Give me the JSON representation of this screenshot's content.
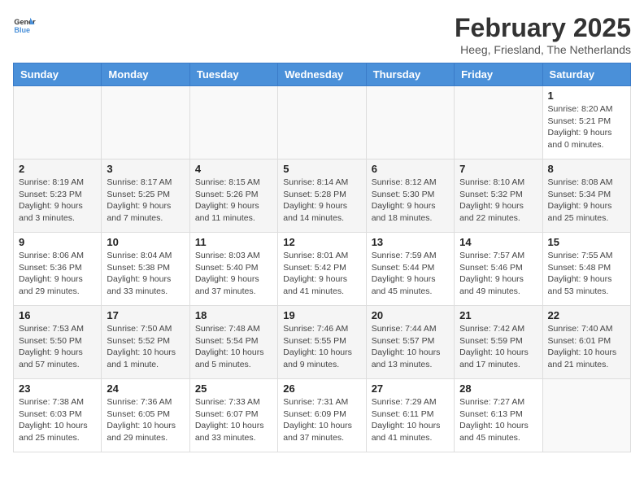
{
  "header": {
    "logo_general": "General",
    "logo_blue": "Blue",
    "title": "February 2025",
    "subtitle": "Heeg, Friesland, The Netherlands"
  },
  "weekdays": [
    "Sunday",
    "Monday",
    "Tuesday",
    "Wednesday",
    "Thursday",
    "Friday",
    "Saturday"
  ],
  "weeks": [
    [
      {
        "day": "",
        "info": ""
      },
      {
        "day": "",
        "info": ""
      },
      {
        "day": "",
        "info": ""
      },
      {
        "day": "",
        "info": ""
      },
      {
        "day": "",
        "info": ""
      },
      {
        "day": "",
        "info": ""
      },
      {
        "day": "1",
        "info": "Sunrise: 8:20 AM\nSunset: 5:21 PM\nDaylight: 9 hours and 0 minutes."
      }
    ],
    [
      {
        "day": "2",
        "info": "Sunrise: 8:19 AM\nSunset: 5:23 PM\nDaylight: 9 hours and 3 minutes."
      },
      {
        "day": "3",
        "info": "Sunrise: 8:17 AM\nSunset: 5:25 PM\nDaylight: 9 hours and 7 minutes."
      },
      {
        "day": "4",
        "info": "Sunrise: 8:15 AM\nSunset: 5:26 PM\nDaylight: 9 hours and 11 minutes."
      },
      {
        "day": "5",
        "info": "Sunrise: 8:14 AM\nSunset: 5:28 PM\nDaylight: 9 hours and 14 minutes."
      },
      {
        "day": "6",
        "info": "Sunrise: 8:12 AM\nSunset: 5:30 PM\nDaylight: 9 hours and 18 minutes."
      },
      {
        "day": "7",
        "info": "Sunrise: 8:10 AM\nSunset: 5:32 PM\nDaylight: 9 hours and 22 minutes."
      },
      {
        "day": "8",
        "info": "Sunrise: 8:08 AM\nSunset: 5:34 PM\nDaylight: 9 hours and 25 minutes."
      }
    ],
    [
      {
        "day": "9",
        "info": "Sunrise: 8:06 AM\nSunset: 5:36 PM\nDaylight: 9 hours and 29 minutes."
      },
      {
        "day": "10",
        "info": "Sunrise: 8:04 AM\nSunset: 5:38 PM\nDaylight: 9 hours and 33 minutes."
      },
      {
        "day": "11",
        "info": "Sunrise: 8:03 AM\nSunset: 5:40 PM\nDaylight: 9 hours and 37 minutes."
      },
      {
        "day": "12",
        "info": "Sunrise: 8:01 AM\nSunset: 5:42 PM\nDaylight: 9 hours and 41 minutes."
      },
      {
        "day": "13",
        "info": "Sunrise: 7:59 AM\nSunset: 5:44 PM\nDaylight: 9 hours and 45 minutes."
      },
      {
        "day": "14",
        "info": "Sunrise: 7:57 AM\nSunset: 5:46 PM\nDaylight: 9 hours and 49 minutes."
      },
      {
        "day": "15",
        "info": "Sunrise: 7:55 AM\nSunset: 5:48 PM\nDaylight: 9 hours and 53 minutes."
      }
    ],
    [
      {
        "day": "16",
        "info": "Sunrise: 7:53 AM\nSunset: 5:50 PM\nDaylight: 9 hours and 57 minutes."
      },
      {
        "day": "17",
        "info": "Sunrise: 7:50 AM\nSunset: 5:52 PM\nDaylight: 10 hours and 1 minute."
      },
      {
        "day": "18",
        "info": "Sunrise: 7:48 AM\nSunset: 5:54 PM\nDaylight: 10 hours and 5 minutes."
      },
      {
        "day": "19",
        "info": "Sunrise: 7:46 AM\nSunset: 5:55 PM\nDaylight: 10 hours and 9 minutes."
      },
      {
        "day": "20",
        "info": "Sunrise: 7:44 AM\nSunset: 5:57 PM\nDaylight: 10 hours and 13 minutes."
      },
      {
        "day": "21",
        "info": "Sunrise: 7:42 AM\nSunset: 5:59 PM\nDaylight: 10 hours and 17 minutes."
      },
      {
        "day": "22",
        "info": "Sunrise: 7:40 AM\nSunset: 6:01 PM\nDaylight: 10 hours and 21 minutes."
      }
    ],
    [
      {
        "day": "23",
        "info": "Sunrise: 7:38 AM\nSunset: 6:03 PM\nDaylight: 10 hours and 25 minutes."
      },
      {
        "day": "24",
        "info": "Sunrise: 7:36 AM\nSunset: 6:05 PM\nDaylight: 10 hours and 29 minutes."
      },
      {
        "day": "25",
        "info": "Sunrise: 7:33 AM\nSunset: 6:07 PM\nDaylight: 10 hours and 33 minutes."
      },
      {
        "day": "26",
        "info": "Sunrise: 7:31 AM\nSunset: 6:09 PM\nDaylight: 10 hours and 37 minutes."
      },
      {
        "day": "27",
        "info": "Sunrise: 7:29 AM\nSunset: 6:11 PM\nDaylight: 10 hours and 41 minutes."
      },
      {
        "day": "28",
        "info": "Sunrise: 7:27 AM\nSunset: 6:13 PM\nDaylight: 10 hours and 45 minutes."
      },
      {
        "day": "",
        "info": ""
      }
    ]
  ]
}
